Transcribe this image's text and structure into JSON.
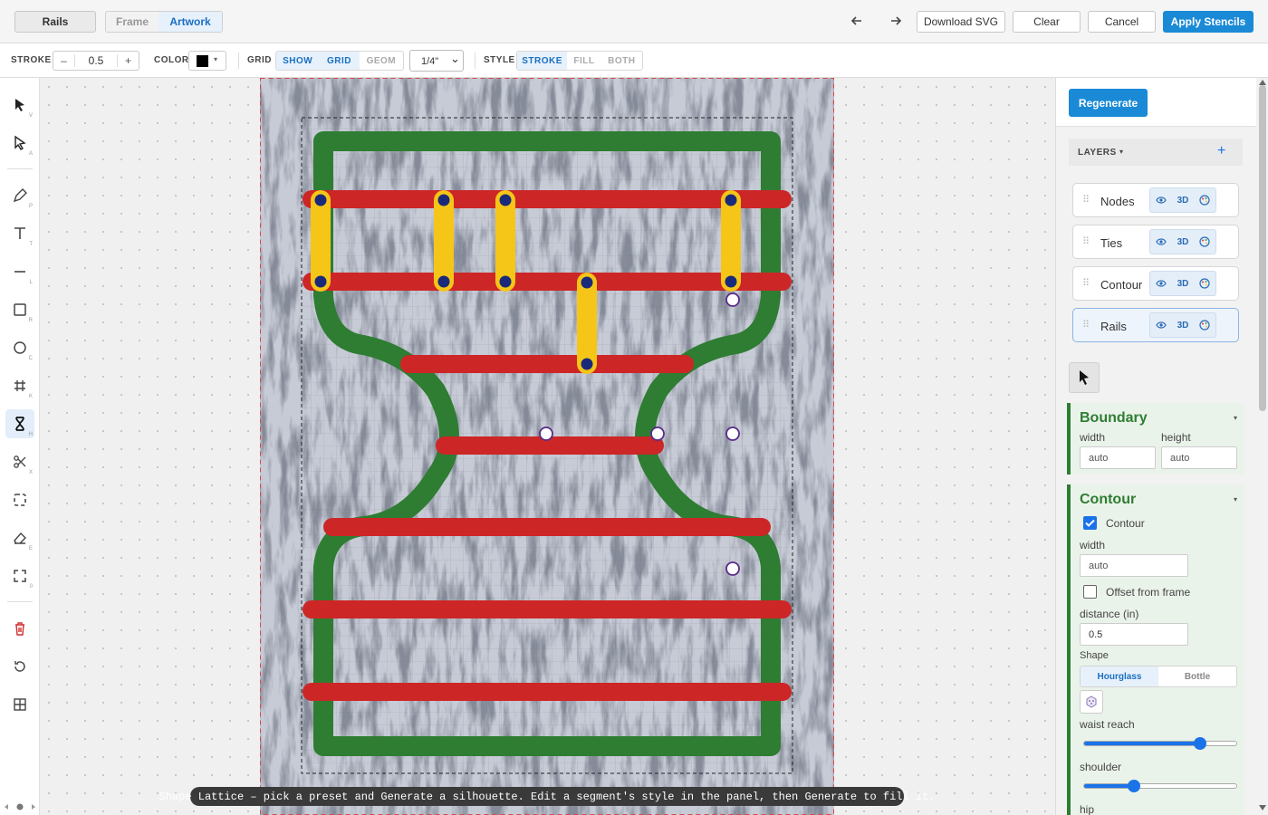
{
  "topbar": {
    "rails_button": "Rails",
    "mode_tabs": [
      {
        "label": "Frame",
        "active": false
      },
      {
        "label": "Artwork",
        "active": true
      }
    ],
    "undo_icon": "arrow-left-icon",
    "redo_icon": "arrow-right-icon",
    "download_svg": "Download SVG",
    "clear": "Clear",
    "cancel": "Cancel",
    "apply": "Apply Stencils"
  },
  "toolbar": {
    "stroke_label": "STROKE",
    "stroke_minus": "–",
    "stroke_value": "0.5",
    "stroke_plus": "+",
    "color_label": "COLOR",
    "color_value": "#000000",
    "color_caret": "▾",
    "grid_label": "GRID",
    "grid_options": [
      "SHOW",
      "GRID",
      "GEOM"
    ],
    "grid_active": [
      "SHOW",
      "GRID"
    ],
    "grid_size": "1/4\"",
    "select_caret": "⌄",
    "style_label": "STYLE",
    "style_options": [
      "STROKE",
      "FILL",
      "BOTH"
    ],
    "style_active": "STROKE"
  },
  "tools": [
    {
      "name": "select",
      "icon": "arrow-pointer-icon",
      "key": "V"
    },
    {
      "name": "direct-select",
      "icon": "hollow-arrow-icon",
      "key": "A"
    },
    {
      "name": "pen",
      "icon": "pen-icon",
      "key": "P"
    },
    {
      "name": "text",
      "icon": "text-icon",
      "key": "T"
    },
    {
      "name": "line",
      "icon": "line-icon",
      "key": "L"
    },
    {
      "name": "rectangle",
      "icon": "rectangle-icon",
      "key": "R"
    },
    {
      "name": "circle",
      "icon": "circle-icon",
      "key": "C"
    },
    {
      "name": "grid",
      "icon": "hash-icon",
      "key": "K"
    },
    {
      "name": "hourglass",
      "icon": "hourglass-icon",
      "key": "H",
      "active": true
    },
    {
      "name": "scissors",
      "icon": "scissors-icon",
      "key": "X"
    },
    {
      "name": "frame",
      "icon": "dashed-frame-icon",
      "key": ""
    },
    {
      "name": "eraser",
      "icon": "eraser-icon",
      "key": "E"
    },
    {
      "name": "fit",
      "icon": "fit-corners-icon",
      "key": "0"
    },
    {
      "name": "delete",
      "icon": "trash-icon",
      "key": ""
    },
    {
      "name": "reset",
      "icon": "rotate-ccw-icon",
      "key": ""
    },
    {
      "name": "layout",
      "icon": "grid-2x2-icon",
      "key": ""
    }
  ],
  "status_message": "Shape Lattice – pick a preset and Generate a silhouette. Edit a segment's style in the panel, then Generate to fill it.",
  "panel": {
    "regenerate": "Regenerate",
    "layers_title": "LAYERS",
    "layers_caret": "▾",
    "add_layer": "+",
    "layers": [
      {
        "name": "Nodes",
        "selected": false
      },
      {
        "name": "Ties",
        "selected": false
      },
      {
        "name": "Contour",
        "selected": false
      },
      {
        "name": "Rails",
        "selected": true
      }
    ],
    "layer_3d": "3D",
    "boundary": {
      "title": "Boundary",
      "caret": "▾",
      "width_label": "width",
      "height_label": "height",
      "width_value": "auto",
      "height_value": "auto"
    },
    "contour": {
      "title": "Contour",
      "caret": "▾",
      "contour_checkbox": "Contour",
      "contour_checked": true,
      "width_label": "width",
      "width_value": "auto",
      "offset_label": "Offset from frame",
      "offset_checked": false,
      "distance_label": "distance (in)",
      "distance_value": "0.5",
      "shape_label": "Shape",
      "shape_options": [
        "Hourglass",
        "Bottle"
      ],
      "shape_active": "Hourglass",
      "waist_reach_label": "waist reach",
      "waist_reach_value": 0.76,
      "shoulder_label": "shoulder",
      "shoulder_value": 0.33,
      "hip_label": "hip"
    }
  },
  "colors": {
    "accent": "#1a8ad6",
    "contour": "#2e7d32",
    "rail": "#cc2626",
    "tie": "#f5c518",
    "node": "#1a2a7a",
    "section_green": "#2e7d32"
  }
}
